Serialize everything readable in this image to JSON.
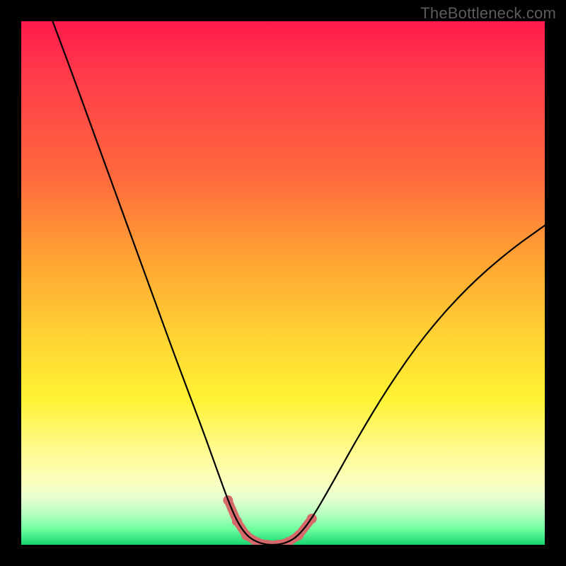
{
  "watermark": "TheBottleneck.com",
  "chart_data": {
    "type": "line",
    "title": "",
    "xlabel": "",
    "ylabel": "",
    "xlim": [
      0,
      1
    ],
    "ylim": [
      0,
      1
    ],
    "background_gradient_stops": [
      {
        "pos": 0.0,
        "color": "#ff1a4d"
      },
      {
        "pos": 0.1,
        "color": "#ff3a4a"
      },
      {
        "pos": 0.3,
        "color": "#ff6a3d"
      },
      {
        "pos": 0.45,
        "color": "#ffa233"
      },
      {
        "pos": 0.6,
        "color": "#ffd233"
      },
      {
        "pos": 0.72,
        "color": "#fff233"
      },
      {
        "pos": 0.82,
        "color": "#fffb8f"
      },
      {
        "pos": 0.88,
        "color": "#fbffbf"
      },
      {
        "pos": 0.91,
        "color": "#e7ffd0"
      },
      {
        "pos": 0.94,
        "color": "#b8ffc0"
      },
      {
        "pos": 0.97,
        "color": "#6fffa0"
      },
      {
        "pos": 1.0,
        "color": "#18d66f"
      }
    ],
    "series": [
      {
        "name": "bottleneck-curve",
        "color": "#000000",
        "stroke_width": 2.2,
        "x": [
          0.06,
          0.09,
          0.13,
          0.17,
          0.21,
          0.25,
          0.29,
          0.32,
          0.35,
          0.375,
          0.395,
          0.412,
          0.43,
          0.45,
          0.47,
          0.49,
          0.51,
          0.53,
          0.555,
          0.59,
          0.64,
          0.7,
          0.77,
          0.85,
          0.93,
          1.0
        ],
        "y": [
          1.0,
          0.92,
          0.81,
          0.7,
          0.59,
          0.48,
          0.37,
          0.29,
          0.21,
          0.14,
          0.085,
          0.045,
          0.018,
          0.005,
          0.0,
          0.0,
          0.005,
          0.018,
          0.05,
          0.11,
          0.2,
          0.3,
          0.4,
          0.49,
          0.56,
          0.61
        ]
      },
      {
        "name": "bottom-markers",
        "type": "scatter",
        "color": "#d66a6a",
        "marker_radius": 7,
        "x": [
          0.395,
          0.412,
          0.43,
          0.45,
          0.47,
          0.49,
          0.51,
          0.53,
          0.555
        ],
        "y": [
          0.085,
          0.045,
          0.018,
          0.005,
          0.0,
          0.0,
          0.005,
          0.018,
          0.05
        ]
      },
      {
        "name": "bottom-band",
        "type": "line",
        "color": "#d66a6a",
        "stroke_width": 12,
        "x": [
          0.395,
          0.412,
          0.43,
          0.45,
          0.47,
          0.49,
          0.51,
          0.53,
          0.555
        ],
        "y": [
          0.085,
          0.045,
          0.018,
          0.005,
          0.0,
          0.0,
          0.005,
          0.018,
          0.05
        ]
      }
    ]
  }
}
